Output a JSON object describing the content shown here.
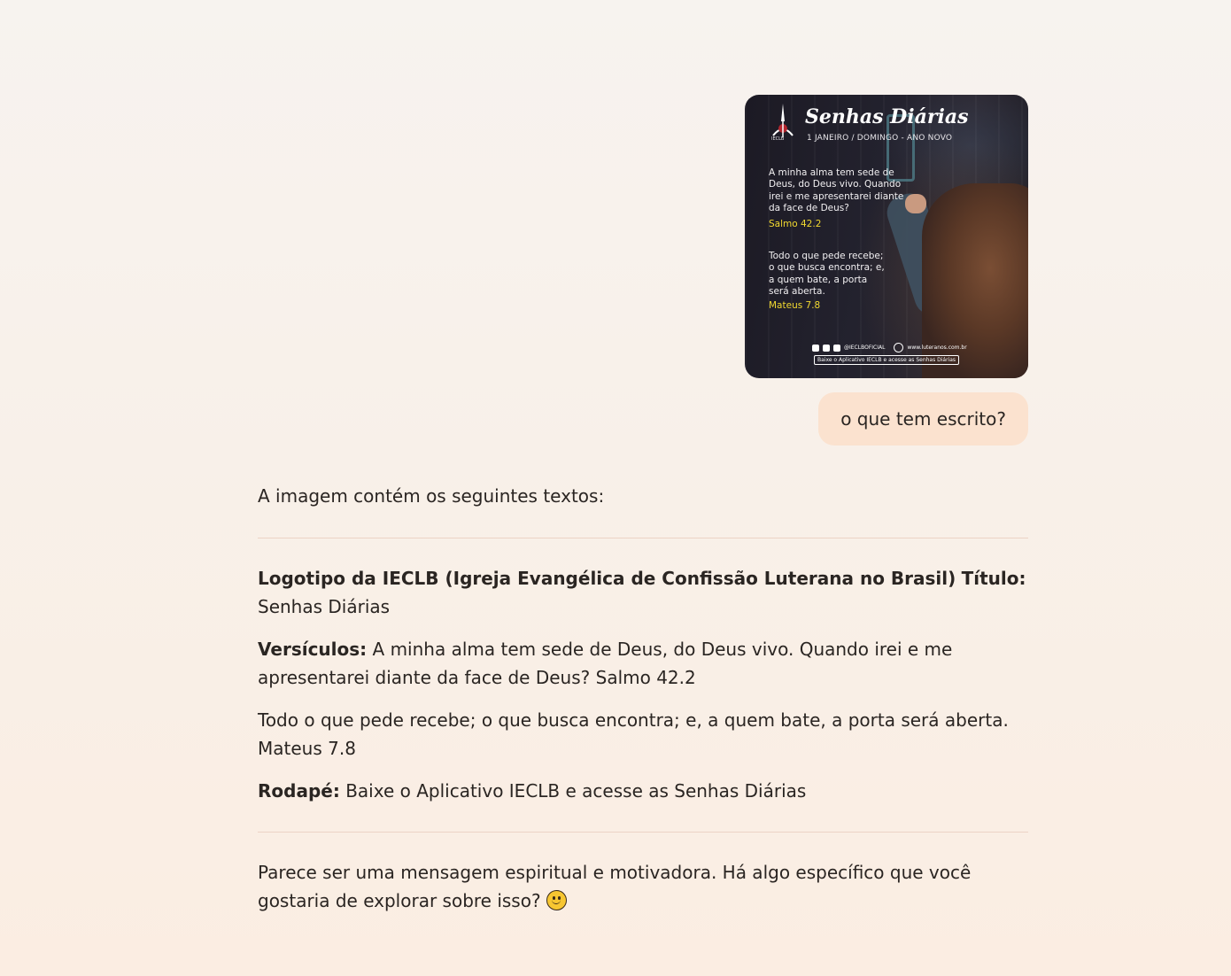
{
  "attachment": {
    "title": "Senhas Diárias",
    "logo_text": "IECLB",
    "date_line": "1 JANEIRO / DOMINGO - ANO NOVO",
    "verse1": "A minha alma tem sede de Deus, do Deus vivo. Quando irei e me apresentarei diante da face de Deus?",
    "ref1": "Salmo 42.2",
    "verse2": "Todo o que pede recebe; o que busca encontra; e, a quem bate, a porta será aberta.",
    "ref2": "Mateus 7.8",
    "social_handle": "@IECLBOFICIAL",
    "website": "www.luteranos.com.br",
    "footer_box": "Baixe o Aplicativo IECLB e acesse as Senhas Diárias"
  },
  "user_message": "o que tem escrito?",
  "response": {
    "intro": "A imagem contém os seguintes textos:",
    "logo_label": "Logotipo da IECLB (Igreja Evangélica de Confissão Luterana no Brasil)",
    "title_label": "Título:",
    "title_value": "Senhas Diárias",
    "verses_label": "Versículos:",
    "verses_text": "A minha alma tem sede de Deus, do Deus vivo. Quando irei e me apresentarei diante da face de Deus? Salmo 42.2",
    "verse2_text": "Todo o que pede recebe; o que busca encontra; e, a quem bate, a porta será aberta. Mateus 7.8",
    "footer_label": "Rodapé:",
    "footer_text": "Baixe o Aplicativo IECLB e acesse as Senhas Diárias",
    "closing": "Parece ser uma mensagem espiritual e motivadora. Há algo específico que você gostaria de explorar sobre isso?"
  },
  "icons": {
    "closing_emoji": "slightly-smiling-face-icon"
  }
}
